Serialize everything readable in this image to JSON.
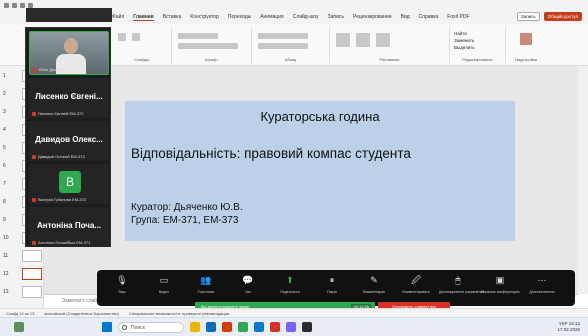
{
  "ribbon": {
    "tabs": [
      "Файл",
      "Главная",
      "Вставка",
      "Конструктор",
      "Переходы",
      "Анимация",
      "Слайд-шоу",
      "Запись",
      "Рецензирование",
      "Вид",
      "Справка",
      "Foxit PDF"
    ],
    "right_buttons": [
      "Запись",
      "Общий доступ"
    ],
    "groups": [
      "Буфер обмена",
      "Слайды",
      "Шрифт",
      "Абзац",
      "Рисование",
      "Редактирование",
      "Надстройки"
    ],
    "find_items": [
      "Найти",
      "Заменить",
      "Выделить"
    ]
  },
  "slide": {
    "title": "Кураторська година",
    "subtitle": "Відповідальність: правовий компас студента",
    "curator": "Куратор: Дьяченко Ю.В.",
    "group": "Група: ЕМ-371, ЕМ-373"
  },
  "thumbnails": {
    "numbers": [
      "1",
      "2",
      "3",
      "4",
      "5",
      "6",
      "7",
      "8",
      "9",
      "10",
      "11",
      "12",
      "13"
    ]
  },
  "notes_placeholder": "Заметки к слайду",
  "zoom_participants": [
    {
      "name": "",
      "sub": "Юлія Дьяченко",
      "type": "video"
    },
    {
      "name": "Лисенко Євгені...",
      "sub": "Лисенко Євгеній ЕМ-372",
      "type": "name"
    },
    {
      "name": "Давидов Олекс...",
      "sub": "Давидов Олексій ЕМ-373",
      "type": "name"
    },
    {
      "name": "",
      "sub": "Валерія Губанова ЕМ-372",
      "type": "avatar",
      "avatar_letter": "B"
    },
    {
      "name": "Антоніна Поча...",
      "sub": "Антоніна Почапська ЕМ-371",
      "type": "name"
    }
  ],
  "meeting_controls": [
    {
      "label": "Звук",
      "icon": "microphone-icon",
      "glyph": "🎙"
    },
    {
      "label": "Видео",
      "icon": "camera-icon",
      "glyph": "▭"
    },
    {
      "label": "Участники",
      "icon": "participants-icon",
      "glyph": "👥"
    },
    {
      "label": "Чат",
      "icon": "chat-icon",
      "glyph": "💬"
    },
    {
      "label": "Поделиться",
      "icon": "share-icon",
      "glyph": "⬆",
      "green": true
    },
    {
      "label": "Пауза",
      "icon": "pause-icon",
      "glyph": "⏸"
    },
    {
      "label": "Комментарии",
      "icon": "annotate-icon",
      "glyph": "✎"
    },
    {
      "label": "Комментировать",
      "icon": "whiteboard-icon",
      "glyph": "🖉"
    },
    {
      "label": "Дистанционное управление",
      "icon": "remote-control-icon",
      "glyph": "🖱"
    },
    {
      "label": "Показать конференцию",
      "icon": "show-meeting-icon",
      "glyph": "▣"
    },
    {
      "label": "Дополнительно",
      "icon": "more-icon",
      "glyph": "⋯"
    }
  ],
  "share_status": "Вы демонстрируете экран",
  "share_timer": "00:12:35",
  "stop_share_label": "Остановить совместное использование",
  "statusbar": {
    "slide_info": "Слайд 12 из 13",
    "language": "английский (Соединенное Королевство)",
    "accessibility": "Специальные возможности: проверьте рекомендации"
  },
  "taskbar": {
    "search_placeholder": "Поиск",
    "time": "12:12",
    "date": "17.02.2026",
    "language": "УКР",
    "apps": [
      "#f0b400",
      "#0f6cbd",
      "#d83b01",
      "#2fa84f",
      "#0078d4",
      "#d93025",
      "#7b61ff",
      "#2b2b2b"
    ]
  },
  "colors": {
    "slide_bg": "#bcd0e7",
    "accent": "#c43e1c",
    "zoom_green": "#2fb04a",
    "stop_red": "#d93025"
  }
}
